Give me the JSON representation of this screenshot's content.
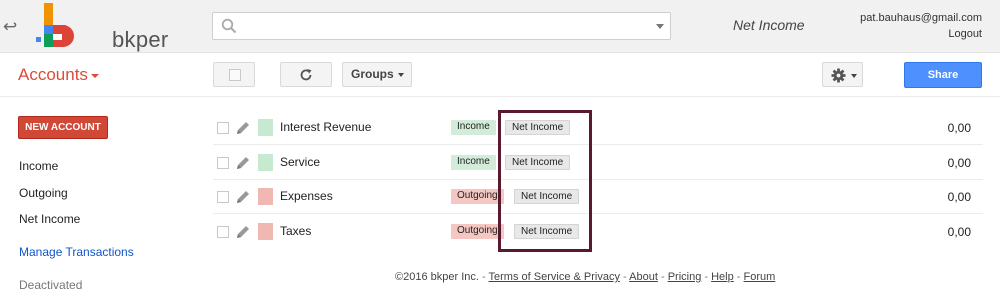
{
  "header": {
    "logo_text": "bkper",
    "search_placeholder": "",
    "book_name": "Net Income",
    "user_email": "pat.bauhaus@gmail.com",
    "logout_label": "Logout"
  },
  "toolbar": {
    "title": "Accounts",
    "groups_label": "Groups",
    "share_label": "Share"
  },
  "sidebar": {
    "new_account_label": "NEW ACCOUNT",
    "items": [
      "Income",
      "Outgoing",
      "Net Income"
    ],
    "manage_transactions_label": "Manage Transactions",
    "deactivated_label": "Deactivated"
  },
  "colors": {
    "income_tag": "#d2ecd9",
    "outgoing_tag": "#f4c7c3",
    "group_tag": "#e8e8e8",
    "income_swatch": "#c7e9cf",
    "outgoing_swatch": "#f0b7b3",
    "accent_red": "#dd4b39",
    "share_blue": "#4d90fe"
  },
  "accounts": [
    {
      "name": "Interest Revenue",
      "type": "Income",
      "group": "Net Income",
      "balance": "0,00"
    },
    {
      "name": "Service",
      "type": "Income",
      "group": "Net Income",
      "balance": "0,00"
    },
    {
      "name": "Expenses",
      "type": "Outgoing",
      "group": "Net Income",
      "balance": "0,00"
    },
    {
      "name": "Taxes",
      "type": "Outgoing",
      "group": "Net Income",
      "balance": "0,00"
    }
  ],
  "footer": {
    "copyright": "©2016 bkper Inc.",
    "links": [
      "Terms of Service & Privacy",
      "About",
      "Pricing",
      "Help",
      "Forum"
    ]
  }
}
